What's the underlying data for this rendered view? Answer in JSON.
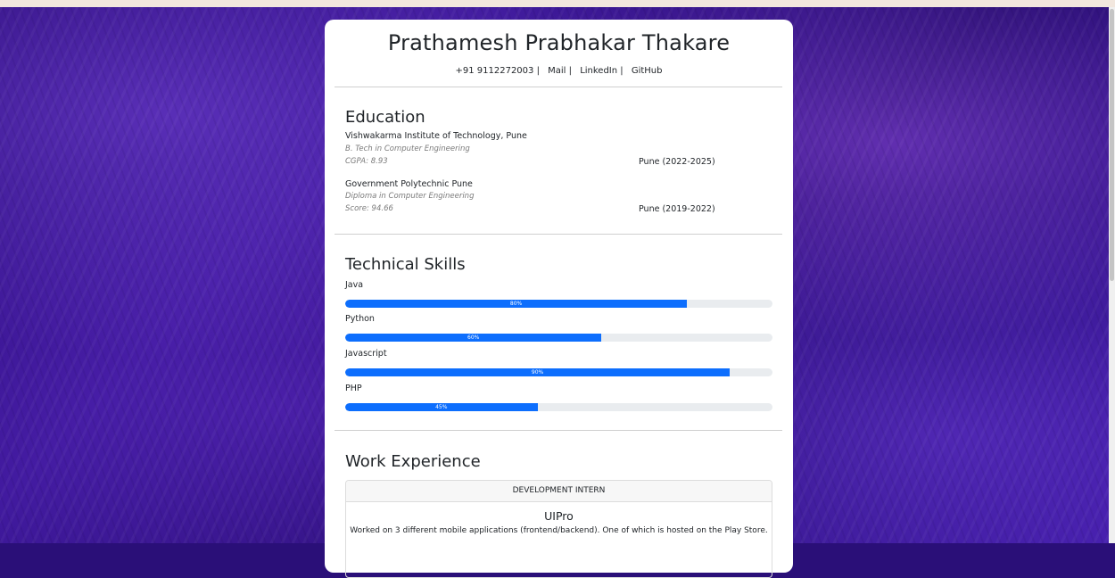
{
  "profile": {
    "name": "Prathamesh Prabhakar Thakare",
    "contacts": [
      "+91 9112272003 |",
      "Mail |",
      "LinkedIn |",
      "GitHub"
    ]
  },
  "education": {
    "title": "Education",
    "items": [
      {
        "institution": "Vishwakarma Institute of Technology, Pune",
        "degree": "B. Tech in Computer Engineering",
        "score": "CGPA: 8.93",
        "location": "Pune (2022-2025)"
      },
      {
        "institution": "Government Polytechnic Pune",
        "degree": "Diploma in Computer Engineering",
        "score": "Score: 94.66",
        "location": "Pune (2019-2022)"
      }
    ]
  },
  "skills": {
    "title": "Technical Skills",
    "items": [
      {
        "name": "Java",
        "percent_label": "80%",
        "percent": 80
      },
      {
        "name": "Python",
        "percent_label": "60%",
        "percent": 60
      },
      {
        "name": "Javascript",
        "percent_label": "90%",
        "percent": 90
      },
      {
        "name": "PHP",
        "percent_label": "45%",
        "percent": 45
      }
    ]
  },
  "work": {
    "title": "Work Experience",
    "items": [
      {
        "role": "DEVELOPMENT INTERN",
        "company": "UIPro",
        "description": "Worked on 3 different mobile applications (frontend/backend). One of which is hosted on the Play Store."
      }
    ]
  },
  "colors": {
    "accent": "#0d6efd",
    "track": "#e9ecef",
    "background": "#2a0f78"
  }
}
